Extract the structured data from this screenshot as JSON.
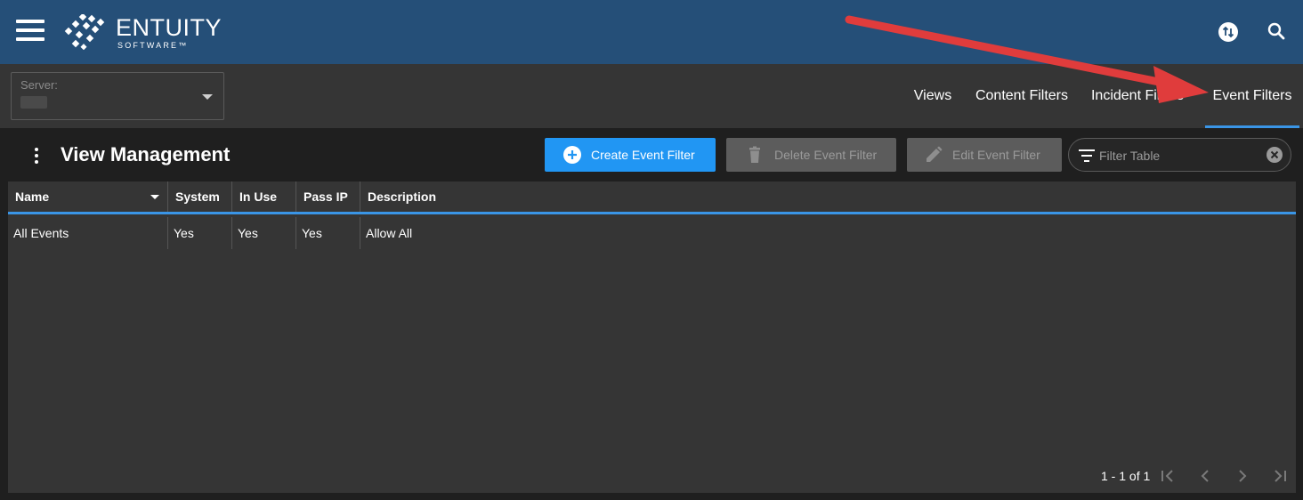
{
  "header": {
    "logo_text": "ENTUITY",
    "logo_subtext": "SOFTWARE™",
    "icons": [
      "menu-icon",
      "sync-icon",
      "search-icon"
    ]
  },
  "server_select": {
    "label": "Server:"
  },
  "tabs": [
    {
      "label": "Views",
      "active": false
    },
    {
      "label": "Content Filters",
      "active": false
    },
    {
      "label": "Incident Filters",
      "active": false
    },
    {
      "label": "Event Filters",
      "active": true
    }
  ],
  "panel": {
    "title": "View Management",
    "create_label": "Create Event Filter",
    "delete_label": "Delete Event Filter",
    "edit_label": "Edit Event Filter",
    "filter_placeholder": "Filter Table"
  },
  "table": {
    "columns": [
      "Name",
      "System",
      "In Use",
      "Pass IP",
      "Description"
    ],
    "rows": [
      [
        "All Events",
        "Yes",
        "Yes",
        "Yes",
        "Allow All"
      ]
    ]
  },
  "pagination": {
    "summary": "1 - 1 of 1"
  },
  "colors": {
    "header_bg": "#254f78",
    "accent": "#2196f3",
    "tab_underline": "#3a95e6",
    "annotation_arrow": "#e03c3c"
  }
}
